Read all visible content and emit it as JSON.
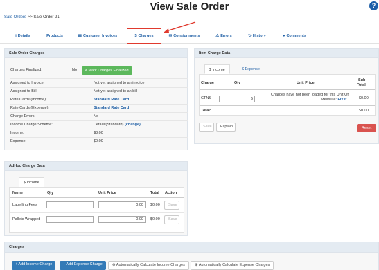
{
  "page": {
    "title": "View Sale Order"
  },
  "breadcrumb": {
    "root": "Sale Orders",
    "separator": ">>",
    "current": "Sale Order 21"
  },
  "tabs": [
    {
      "icon": "i",
      "label": "Details"
    },
    {
      "icon": "",
      "label": "Products"
    },
    {
      "icon": "▤",
      "label": "Customer Invoices"
    },
    {
      "icon": "$",
      "label": "Charges"
    },
    {
      "icon": "✉",
      "label": "Consignments"
    },
    {
      "icon": "⚠",
      "label": "Errors"
    },
    {
      "icon": "↻",
      "label": "History"
    },
    {
      "icon": "●",
      "label": "Comments"
    }
  ],
  "sale_order_charges": {
    "title": "Sale Order Charges",
    "charges_finalized_label": "Charges Finalized:",
    "charges_finalized_value": "No",
    "mark_finalized_button": "Mark Charges Finalized",
    "rows": [
      {
        "label": "Assigned to Invoice:",
        "value": "Not yet assigned to an invoice"
      },
      {
        "label": "Assigned to Bill:",
        "value": "Not yet assigned to an bill"
      },
      {
        "label": "Rate Cards (Income):",
        "value": "Standard Rate Card"
      },
      {
        "label": "Rate Cards (Expense):",
        "value": "Standard Rate Card"
      },
      {
        "label": "Charge Errors:",
        "value": "No"
      },
      {
        "label": "Income Charge Scheme:",
        "value": "Default(Standard)"
      },
      {
        "label": "Income:",
        "value": "$3.00"
      },
      {
        "label": "Expense:",
        "value": "$0.00"
      }
    ],
    "change_link": "(change)"
  },
  "item_charge_data": {
    "title": "Item Charge Data",
    "tab_income": "$ Income",
    "tab_expense": "$ Expense",
    "headers": {
      "charge": "Charge",
      "qty": "Qty",
      "unit_price": "Unit Price",
      "subtotal_1": "Sub",
      "subtotal_2": "Total"
    },
    "row": {
      "charge": "CTNS",
      "qty": "5",
      "message": "Charges have not been loaded for this Unit Of",
      "message_2": "Measure:",
      "fix_link": "Fix It",
      "subtotal": "$0.00"
    },
    "total_label": "Total:",
    "total_value": "$0.00",
    "save_button": "Save",
    "explain_button": "Explain",
    "reset_button": "Reset"
  },
  "adhoc_charge_data": {
    "title": "AdHoc Charge Data",
    "tab_income": "$ Income",
    "headers": {
      "name": "Name",
      "qty": "Qty",
      "unit_price": "Unit Price",
      "total": "Total",
      "action": "Action"
    },
    "rows": [
      {
        "name": "Labelling Fees",
        "qty": "",
        "unit_price": "0.00",
        "total": "$0.00",
        "action": "Save"
      },
      {
        "name": "Pallets Wrapped",
        "qty": "",
        "unit_price": "0.00",
        "total": "$0.00",
        "action": "Save"
      }
    ]
  },
  "charges_section": {
    "title": "Charges",
    "buttons": [
      "+ Add Income Charge",
      "+ Add Expense Charge",
      "⊕ Automatically Calculate Income Charges",
      "⊕ Automatically Calculate Expense Charges"
    ]
  }
}
